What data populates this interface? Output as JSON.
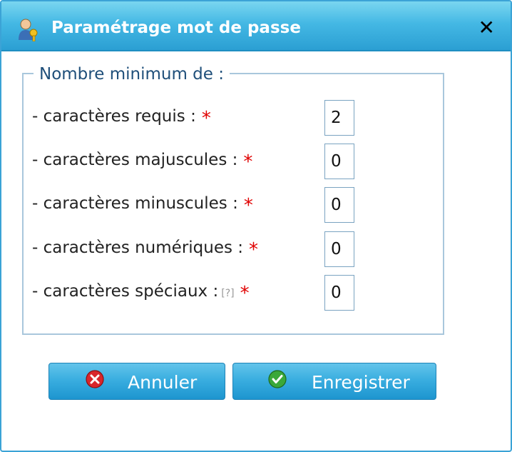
{
  "dialog": {
    "title": "Paramétrage mot de passe",
    "close_label": "✕",
    "icon": "user-key-icon"
  },
  "fieldset": {
    "legend": "Nombre minimum de :",
    "rows": [
      {
        "label": "- caractères requis :",
        "required": "*",
        "value": "2"
      },
      {
        "label": "- caractères majuscules :",
        "required": "*",
        "value": "0"
      },
      {
        "label": "- caractères minuscules :",
        "required": "*",
        "value": "0"
      },
      {
        "label": "- caractères numériques :",
        "required": "*",
        "value": "0"
      },
      {
        "label": "- caractères spéciaux :",
        "help": "[?]",
        "required": "*",
        "value": "0"
      }
    ]
  },
  "buttons": {
    "cancel_label": "Annuler",
    "save_label": "Enregistrer",
    "cancel_icon": "cancel-icon",
    "save_icon": "check-icon"
  },
  "colors": {
    "titlebar": "#44b8e4",
    "button": "#3aaee0",
    "required": "#e00000",
    "legend": "#1f4f7a"
  }
}
